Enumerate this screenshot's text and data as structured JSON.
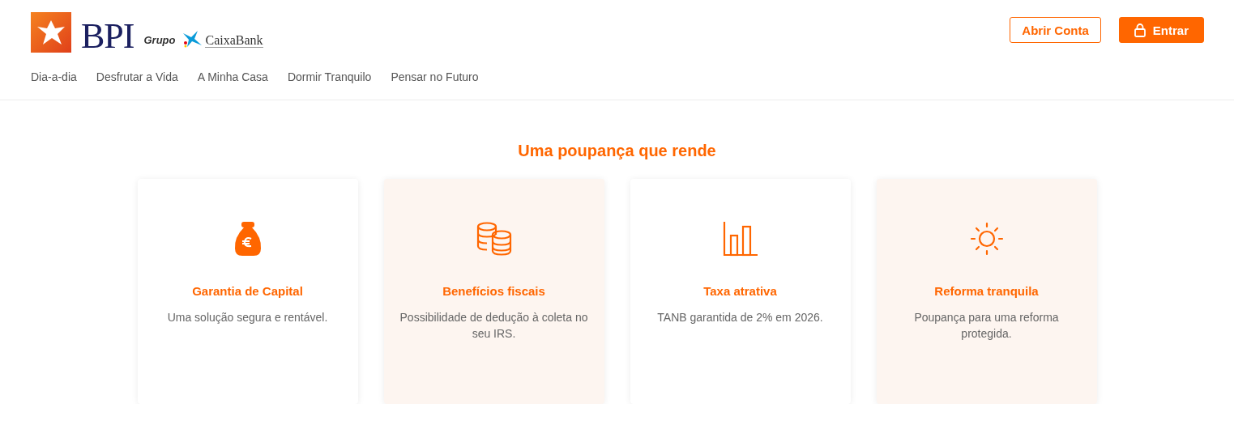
{
  "header": {
    "logo": {
      "brand": "BPI",
      "group_label": "Grupo",
      "partner": "CaixaBank"
    },
    "nav": [
      {
        "label": "Dia-a-dia"
      },
      {
        "label": "Desfrutar a Vida"
      },
      {
        "label": "A Minha Casa"
      },
      {
        "label": "Dormir Tranquilo"
      },
      {
        "label": "Pensar no Futuro"
      }
    ],
    "buttons": [
      {
        "label": "Abrir Conta",
        "kind": "outline"
      },
      {
        "label": "Entrar",
        "kind": "filled"
      }
    ]
  },
  "section": {
    "title": "Uma poupança que rende",
    "cards": [
      {
        "kind": "moneybag",
        "title": "Garantia de Capital",
        "text": "Uma solução segura e rentável.",
        "tinted": false
      },
      {
        "kind": "coins",
        "title": "Benefícios fiscais",
        "text": "Possibilidade de dedução à coleta no seu IRS.",
        "tinted": true
      },
      {
        "kind": "chart",
        "title": "Taxa atrativa",
        "text": "TANB garantida de 2% em 2026.",
        "tinted": false
      },
      {
        "kind": "sun",
        "title": "Reforma tranquila",
        "text": "Poupança para uma reforma protegida.",
        "tinted": true
      }
    ]
  }
}
